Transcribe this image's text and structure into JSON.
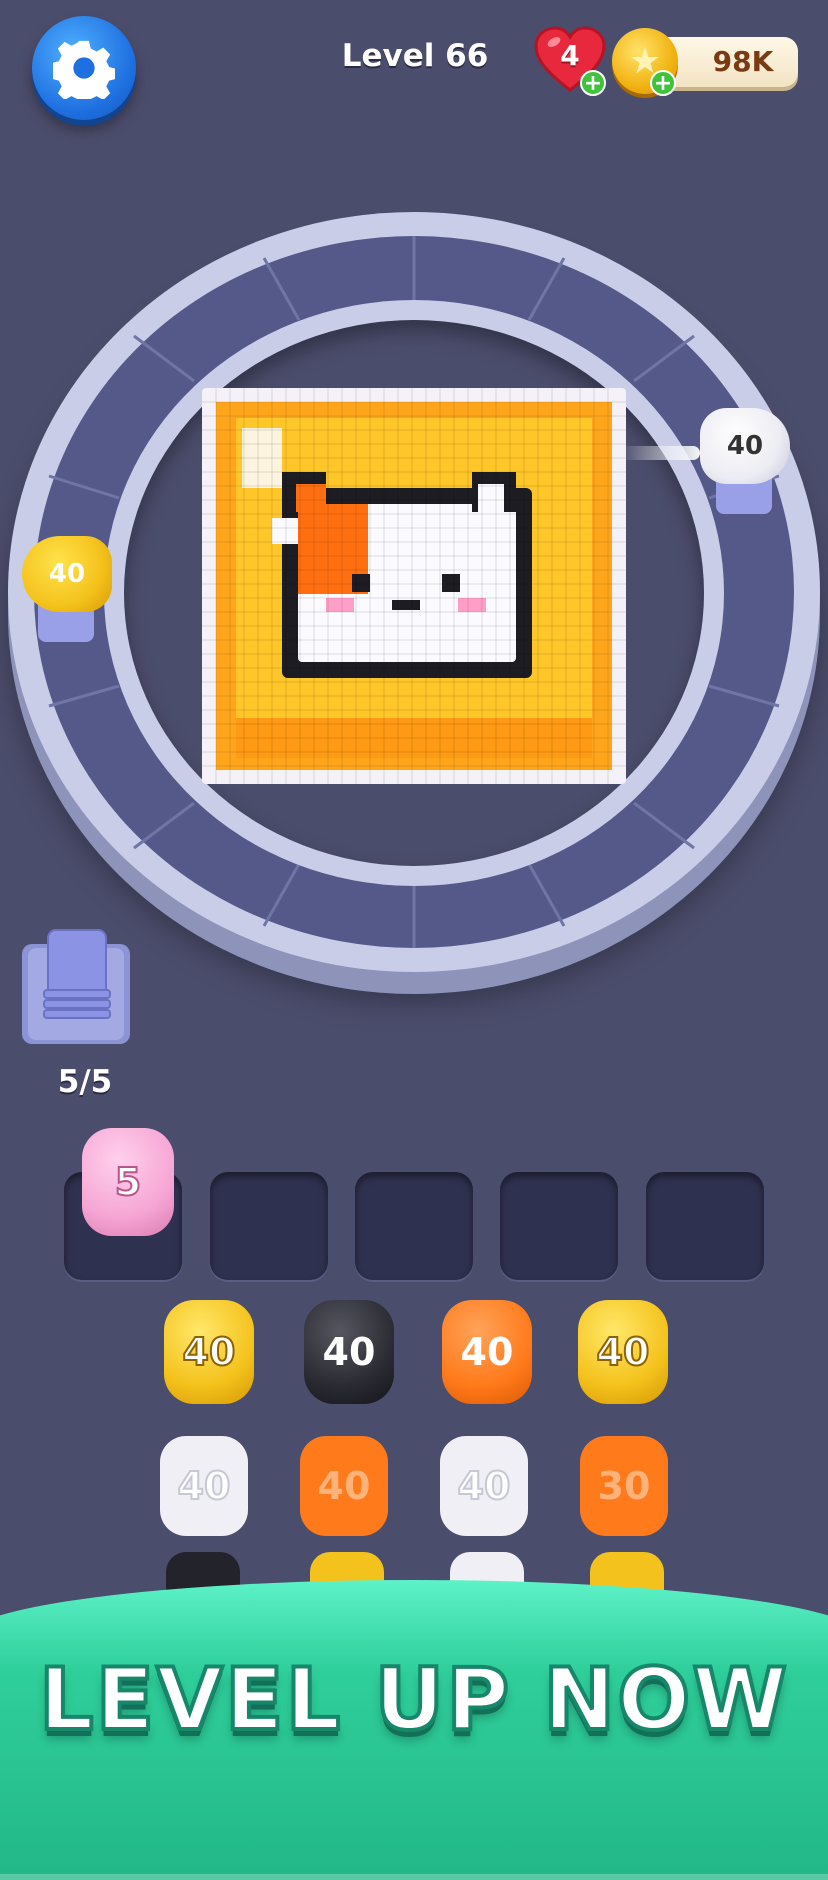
{
  "header": {
    "settings_icon": "gear-icon",
    "level_label": "Level 66",
    "lives": "4",
    "lives_icon": "heart-icon",
    "coins": "98K",
    "coin_icon": "star-coin-icon",
    "add_icon": "plus-icon"
  },
  "board": {
    "picture": "pixel-cat-icon",
    "shooters": [
      {
        "color": "#f4c21c",
        "count": "40",
        "position_label": "left"
      },
      {
        "color": "#f2f2f6",
        "count": "40",
        "position_label": "right"
      }
    ]
  },
  "stack": {
    "count": "5/5",
    "icon": "plate-stack-icon"
  },
  "slots": {
    "filled": {
      "color": "#f6a6d4",
      "count": "5"
    },
    "empty_count": 4
  },
  "queue": {
    "row1": [
      {
        "color": "#f4c21c",
        "count": "40"
      },
      {
        "color": "#2a2b33",
        "count": "40"
      },
      {
        "color": "#ff7a1a",
        "count": "40"
      },
      {
        "color": "#f4c21c",
        "count": "40"
      }
    ],
    "row2": [
      {
        "color": "#f2f2f6",
        "count": "40"
      },
      {
        "color": "#ff7a1a",
        "count": "40"
      },
      {
        "color": "#f2f2f6",
        "count": "40"
      },
      {
        "color": "#ff7a1a",
        "count": "30"
      }
    ]
  },
  "banner": {
    "label": "LEVEL UP NOW",
    "color": "#2fcf9b"
  }
}
